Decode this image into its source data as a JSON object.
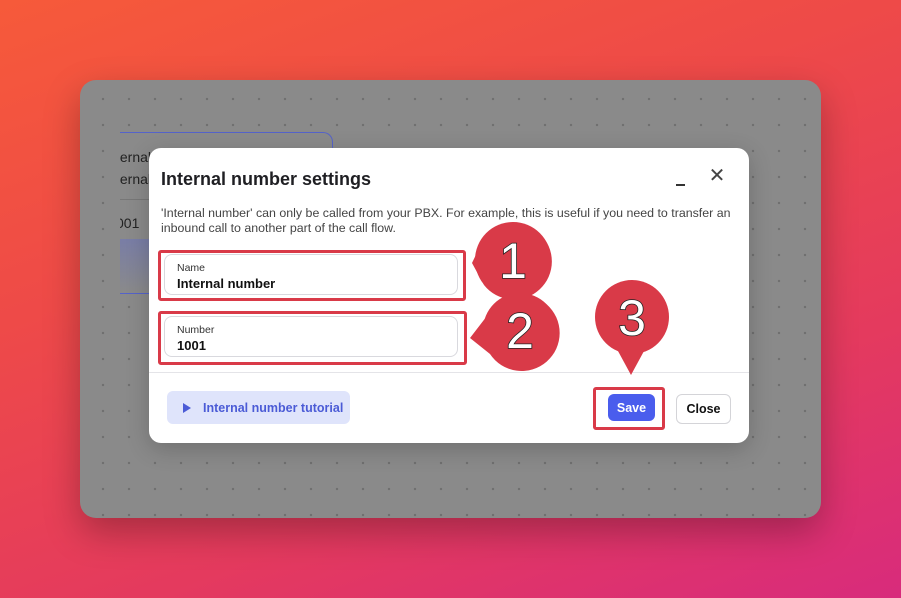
{
  "background_card": {
    "line1": "ternal",
    "line2": "ternal",
    "line3": "001"
  },
  "dialog": {
    "title": "Internal number settings",
    "description": "'Internal number' can only be called from your PBX. For example, this is useful if you need to transfer an inbound call to another part of the call flow.",
    "fields": {
      "name": {
        "label": "Name",
        "value": "Internal number"
      },
      "number": {
        "label": "Number",
        "value": "1001"
      }
    },
    "footer": {
      "tutorial_label": "Internal number tutorial",
      "save_label": "Save",
      "close_label": "Close"
    }
  },
  "annotations": {
    "callout_1": "1",
    "callout_2": "2",
    "callout_3": "3",
    "color": "#d93a48"
  },
  "colors": {
    "primary": "#4a5ded",
    "tutorial_bg": "#dfe4fb",
    "tutorial_text": "#4b5bd6"
  },
  "icons": {
    "tutorial": "play-icon",
    "minimize": "minimize-icon",
    "close": "close-icon"
  }
}
